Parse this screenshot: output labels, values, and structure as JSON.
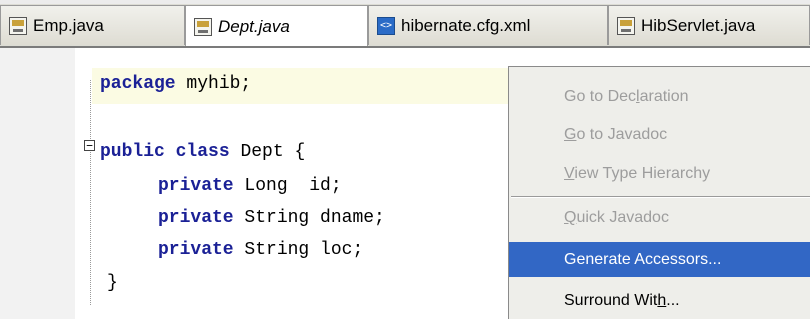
{
  "tabs": [
    {
      "label": "Emp.java",
      "icon": "java-file-icon",
      "active": false,
      "italic": false
    },
    {
      "label": "Dept.java",
      "icon": "java-file-icon",
      "active": true,
      "italic": true
    },
    {
      "label": "hibernate.cfg.xml",
      "icon": "xml-file-icon",
      "active": false,
      "italic": false
    },
    {
      "label": "HibServlet.java",
      "icon": "java-file-icon",
      "active": false,
      "italic": false
    }
  ],
  "code": {
    "line1_kw": "package",
    "line1_rest": " myhib;",
    "line2_kw1": "public",
    "line2_kw2": "class",
    "line2_rest": " Dept {",
    "line3_kw": "private",
    "line3_rest": " Long  id;",
    "line4_kw": "private",
    "line4_rest": " String dname;",
    "line5_kw": "private",
    "line5_rest": " String loc;",
    "line6": "}",
    "fold_symbol": "−"
  },
  "context_menu": {
    "items": [
      {
        "pre": "Go to Dec",
        "u": "l",
        "post": "aration",
        "enabled": false
      },
      {
        "pre": "",
        "u": "G",
        "post": "o to Javadoc",
        "enabled": false
      },
      {
        "pre": "",
        "u": "V",
        "post": "iew Type Hierarchy",
        "enabled": false
      },
      {
        "pre": "",
        "u": "Q",
        "post": "uick Javadoc",
        "enabled": false
      },
      {
        "pre": "Generate Accessors...",
        "u": "",
        "post": "",
        "enabled": true,
        "selected": true
      },
      {
        "pre": "Surround Wit",
        "u": "h",
        "post": "...",
        "enabled": true
      }
    ]
  },
  "colors": {
    "keyword": "#1b2196",
    "menu_selection": "#3267c5",
    "current_line": "#fbfbe3"
  }
}
